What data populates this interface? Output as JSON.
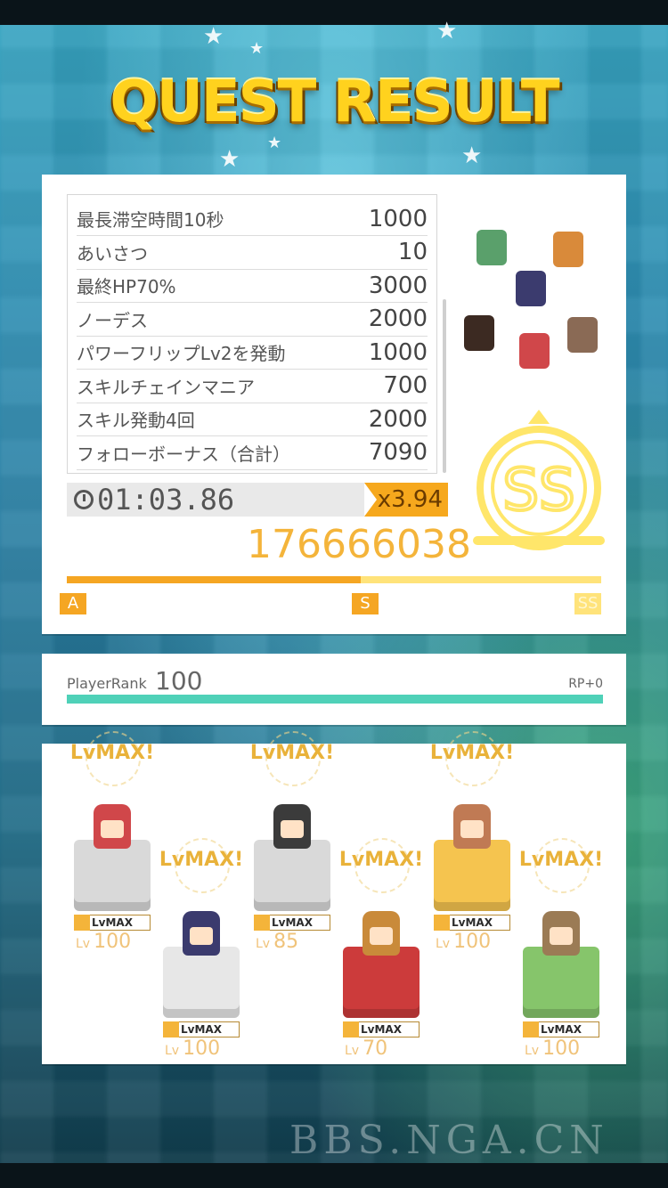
{
  "title": "QUEST RESULT",
  "score_rows": [
    {
      "label": "最長滞空時間10秒",
      "value": "1000"
    },
    {
      "label": "あいさつ",
      "value": "10"
    },
    {
      "label": "最終HP70%",
      "value": "3000"
    },
    {
      "label": "ノーデス",
      "value": "2000"
    },
    {
      "label": "パワーフリップLv2を発動",
      "value": "1000"
    },
    {
      "label": "スキルチェインマニア",
      "value": "700"
    },
    {
      "label": "スキル発動4回",
      "value": "2000"
    },
    {
      "label": "フォローボーナス（合計）",
      "value": "7090"
    }
  ],
  "timer": "01:03.86",
  "multiplier": "x3.94",
  "total_score": "176666038",
  "rank_grade": "SS",
  "gauge": {
    "fill_fraction": 0.55,
    "marks": [
      "A",
      "S",
      "SS"
    ]
  },
  "player_rank": {
    "label": "PlayerRank",
    "value": "100",
    "rp": "RP+0"
  },
  "party": [
    {
      "lvmax": "LvMAX!",
      "badge": "LvMAX",
      "lv_prefix": "Lv",
      "lv": "100",
      "block_color": "#d9d9d9",
      "hair": "#d0474a"
    },
    {
      "lvmax": "LvMAX!",
      "badge": "LvMAX",
      "lv_prefix": "Lv",
      "lv": "100",
      "block_color": "#e7e7e7",
      "hair": "#3b3b6e"
    },
    {
      "lvmax": "LvMAX!",
      "badge": "LvMAX",
      "lv_prefix": "Lv",
      "lv": "85",
      "block_color": "#d9d9d9",
      "hair": "#3b3b3b"
    },
    {
      "lvmax": "LvMAX!",
      "badge": "LvMAX",
      "lv_prefix": "Lv",
      "lv": "70",
      "block_color": "#cc3b3b",
      "hair": "#c98a3a"
    },
    {
      "lvmax": "LvMAX!",
      "badge": "LvMAX",
      "lv_prefix": "Lv",
      "lv": "100",
      "block_color": "#f5c44f",
      "hair": "#c07a54"
    },
    {
      "lvmax": "LvMAX!",
      "badge": "LvMAX",
      "lv_prefix": "Lv",
      "lv": "100",
      "block_color": "#86c56b",
      "hair": "#9b7b55"
    }
  ],
  "watermark": "BBS.NGA.CN",
  "colors": {
    "accent": "#f5a623",
    "rank_bar": "#4fd1b8",
    "gold": "#ffd21e"
  }
}
